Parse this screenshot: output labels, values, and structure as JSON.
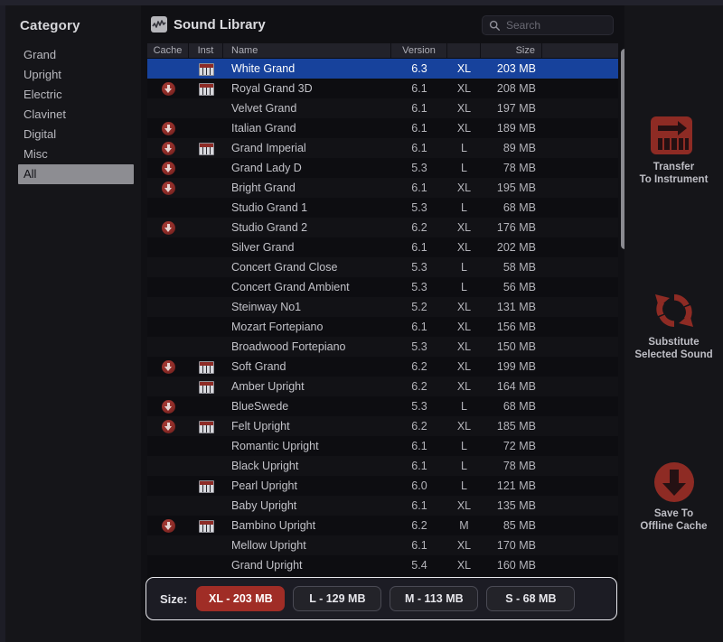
{
  "sidebar": {
    "title": "Category",
    "items": [
      {
        "label": "Grand",
        "selected": false
      },
      {
        "label": "Upright",
        "selected": false
      },
      {
        "label": "Electric",
        "selected": false
      },
      {
        "label": "Clavinet",
        "selected": false
      },
      {
        "label": "Digital",
        "selected": false
      },
      {
        "label": "Misc",
        "selected": false
      },
      {
        "label": "All",
        "selected": true
      }
    ]
  },
  "library": {
    "title": "Sound Library",
    "logo_icon": "waveform-icon",
    "search": {
      "icon": "search-icon",
      "placeholder": "Search",
      "value": ""
    },
    "columns": [
      {
        "key": "cache",
        "label": "Cache"
      },
      {
        "key": "inst",
        "label": "Inst"
      },
      {
        "key": "name",
        "label": "Name"
      },
      {
        "key": "ver",
        "label": "Version"
      },
      {
        "key": "fmt",
        "label": ""
      },
      {
        "key": "size",
        "label": "Size"
      },
      {
        "key": "pad",
        "label": ""
      }
    ],
    "rows": [
      {
        "cache": false,
        "inst": true,
        "name": "White Grand",
        "ver": "6.3",
        "fmt": "XL",
        "size": "203 MB",
        "selected": true
      },
      {
        "cache": true,
        "inst": true,
        "name": "Royal Grand 3D",
        "ver": "6.1",
        "fmt": "XL",
        "size": "208 MB",
        "selected": false
      },
      {
        "cache": false,
        "inst": false,
        "name": "Velvet Grand",
        "ver": "6.1",
        "fmt": "XL",
        "size": "197 MB",
        "selected": false
      },
      {
        "cache": true,
        "inst": false,
        "name": "Italian Grand",
        "ver": "6.1",
        "fmt": "XL",
        "size": "189 MB",
        "selected": false
      },
      {
        "cache": true,
        "inst": true,
        "name": "Grand Imperial",
        "ver": "6.1",
        "fmt": "L",
        "size": "89 MB",
        "selected": false
      },
      {
        "cache": true,
        "inst": false,
        "name": "Grand Lady D",
        "ver": "5.3",
        "fmt": "L",
        "size": "78 MB",
        "selected": false
      },
      {
        "cache": true,
        "inst": false,
        "name": "Bright Grand",
        "ver": "6.1",
        "fmt": "XL",
        "size": "195 MB",
        "selected": false
      },
      {
        "cache": false,
        "inst": false,
        "name": "Studio Grand 1",
        "ver": "5.3",
        "fmt": "L",
        "size": "68 MB",
        "selected": false
      },
      {
        "cache": true,
        "inst": false,
        "name": "Studio Grand 2",
        "ver": "6.2",
        "fmt": "XL",
        "size": "176 MB",
        "selected": false
      },
      {
        "cache": false,
        "inst": false,
        "name": "Silver Grand",
        "ver": "6.1",
        "fmt": "XL",
        "size": "202 MB",
        "selected": false
      },
      {
        "cache": false,
        "inst": false,
        "name": "Concert Grand Close",
        "ver": "5.3",
        "fmt": "L",
        "size": "58 MB",
        "selected": false
      },
      {
        "cache": false,
        "inst": false,
        "name": "Concert Grand Ambient",
        "ver": "5.3",
        "fmt": "L",
        "size": "56 MB",
        "selected": false
      },
      {
        "cache": false,
        "inst": false,
        "name": "Steinway No1",
        "ver": "5.2",
        "fmt": "XL",
        "size": "131 MB",
        "selected": false
      },
      {
        "cache": false,
        "inst": false,
        "name": "Mozart Fortepiano",
        "ver": "6.1",
        "fmt": "XL",
        "size": "156 MB",
        "selected": false
      },
      {
        "cache": false,
        "inst": false,
        "name": "Broadwood Fortepiano",
        "ver": "5.3",
        "fmt": "XL",
        "size": "150 MB",
        "selected": false
      },
      {
        "cache": true,
        "inst": true,
        "name": "Soft Grand",
        "ver": "6.2",
        "fmt": "XL",
        "size": "199 MB",
        "selected": false
      },
      {
        "cache": false,
        "inst": true,
        "name": "Amber Upright",
        "ver": "6.2",
        "fmt": "XL",
        "size": "164 MB",
        "selected": false
      },
      {
        "cache": true,
        "inst": false,
        "name": "BlueSwede",
        "ver": "5.3",
        "fmt": "L",
        "size": "68 MB",
        "selected": false
      },
      {
        "cache": true,
        "inst": true,
        "name": "Felt Upright",
        "ver": "6.2",
        "fmt": "XL",
        "size": "185 MB",
        "selected": false
      },
      {
        "cache": false,
        "inst": false,
        "name": "Romantic Upright",
        "ver": "6.1",
        "fmt": "L",
        "size": "72 MB",
        "selected": false
      },
      {
        "cache": false,
        "inst": false,
        "name": "Black Upright",
        "ver": "6.1",
        "fmt": "L",
        "size": "78 MB",
        "selected": false
      },
      {
        "cache": false,
        "inst": true,
        "name": "Pearl Upright",
        "ver": "6.0",
        "fmt": "L",
        "size": "121 MB",
        "selected": false
      },
      {
        "cache": false,
        "inst": false,
        "name": "Baby Upright",
        "ver": "6.1",
        "fmt": "XL",
        "size": "135 MB",
        "selected": false
      },
      {
        "cache": true,
        "inst": true,
        "name": "Bambino Upright",
        "ver": "6.2",
        "fmt": "M",
        "size": "85 MB",
        "selected": false
      },
      {
        "cache": false,
        "inst": false,
        "name": "Mellow Upright",
        "ver": "6.1",
        "fmt": "XL",
        "size": "170 MB",
        "selected": false
      },
      {
        "cache": false,
        "inst": false,
        "name": "Grand Upright",
        "ver": "5.4",
        "fmt": "XL",
        "size": "160 MB",
        "selected": false
      }
    ]
  },
  "size_bar": {
    "label": "Size:",
    "options": [
      {
        "label": "XL - 203 MB",
        "active": true
      },
      {
        "label": "L - 129 MB",
        "active": false
      },
      {
        "label": "M - 113 MB",
        "active": false
      },
      {
        "label": "S - 68 MB",
        "active": false
      }
    ]
  },
  "actions": [
    {
      "id": "transfer",
      "icon": "transfer-to-instrument-icon",
      "line1": "Transfer",
      "line2": "To Instrument"
    },
    {
      "id": "substitute",
      "icon": "substitute-refresh-icon",
      "line1": "Substitute",
      "line2": "Selected Sound"
    },
    {
      "id": "save",
      "icon": "download-circle-icon",
      "line1": "Save To",
      "line2": "Offline Cache"
    }
  ],
  "colors": {
    "accent_red": "#a02d26",
    "selection_blue": "#17429c",
    "panel_bg": "#101014",
    "sidebar_selected": "#8d8d92"
  }
}
